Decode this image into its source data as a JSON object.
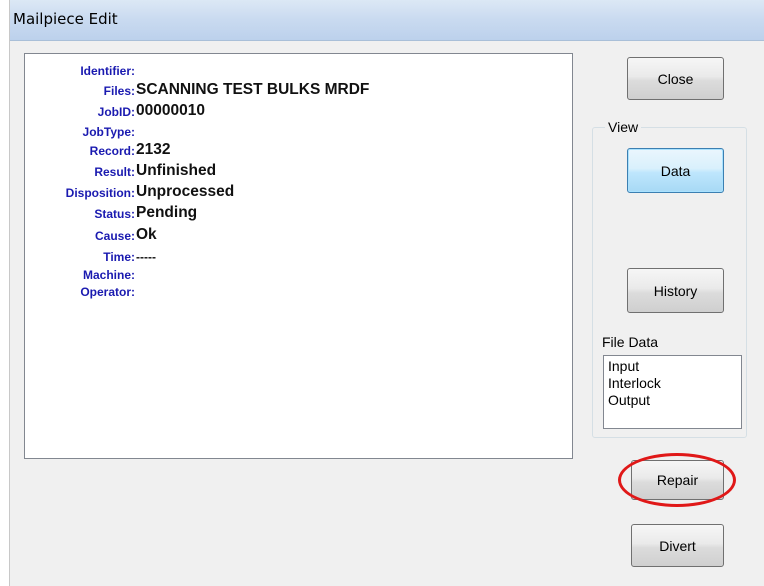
{
  "window": {
    "title": "Mailpiece Edit"
  },
  "details": {
    "fields": [
      {
        "label": "Identifier:",
        "value": ""
      },
      {
        "label": "Files:",
        "value": "SCANNING TEST BULKS MRDF"
      },
      {
        "label": "JobID:",
        "value": "00000010"
      },
      {
        "label": "JobType:",
        "value": ""
      },
      {
        "label": "Record:",
        "value": "2132"
      },
      {
        "label": "Result:",
        "value": "Unfinished"
      },
      {
        "label": "Disposition:",
        "value": "Unprocessed"
      },
      {
        "label": "Status:",
        "value": "Pending"
      },
      {
        "label": "Cause:",
        "value": "Ok"
      },
      {
        "label": "Time:",
        "value": "-----"
      },
      {
        "label": "Machine:",
        "value": ""
      },
      {
        "label": "Operator:",
        "value": ""
      }
    ]
  },
  "buttons": {
    "close": "Close",
    "data": "Data",
    "history": "History",
    "repair": "Repair",
    "divert": "Divert"
  },
  "view_group": {
    "label": "View",
    "active_view": "Data"
  },
  "file_data": {
    "label": "File Data",
    "items": [
      "Input",
      "Interlock",
      "Output"
    ]
  },
  "colors": {
    "label_blue": "#1a1ab0",
    "highlight_ring": "#e01818",
    "titlebar": "#c9daf0"
  }
}
